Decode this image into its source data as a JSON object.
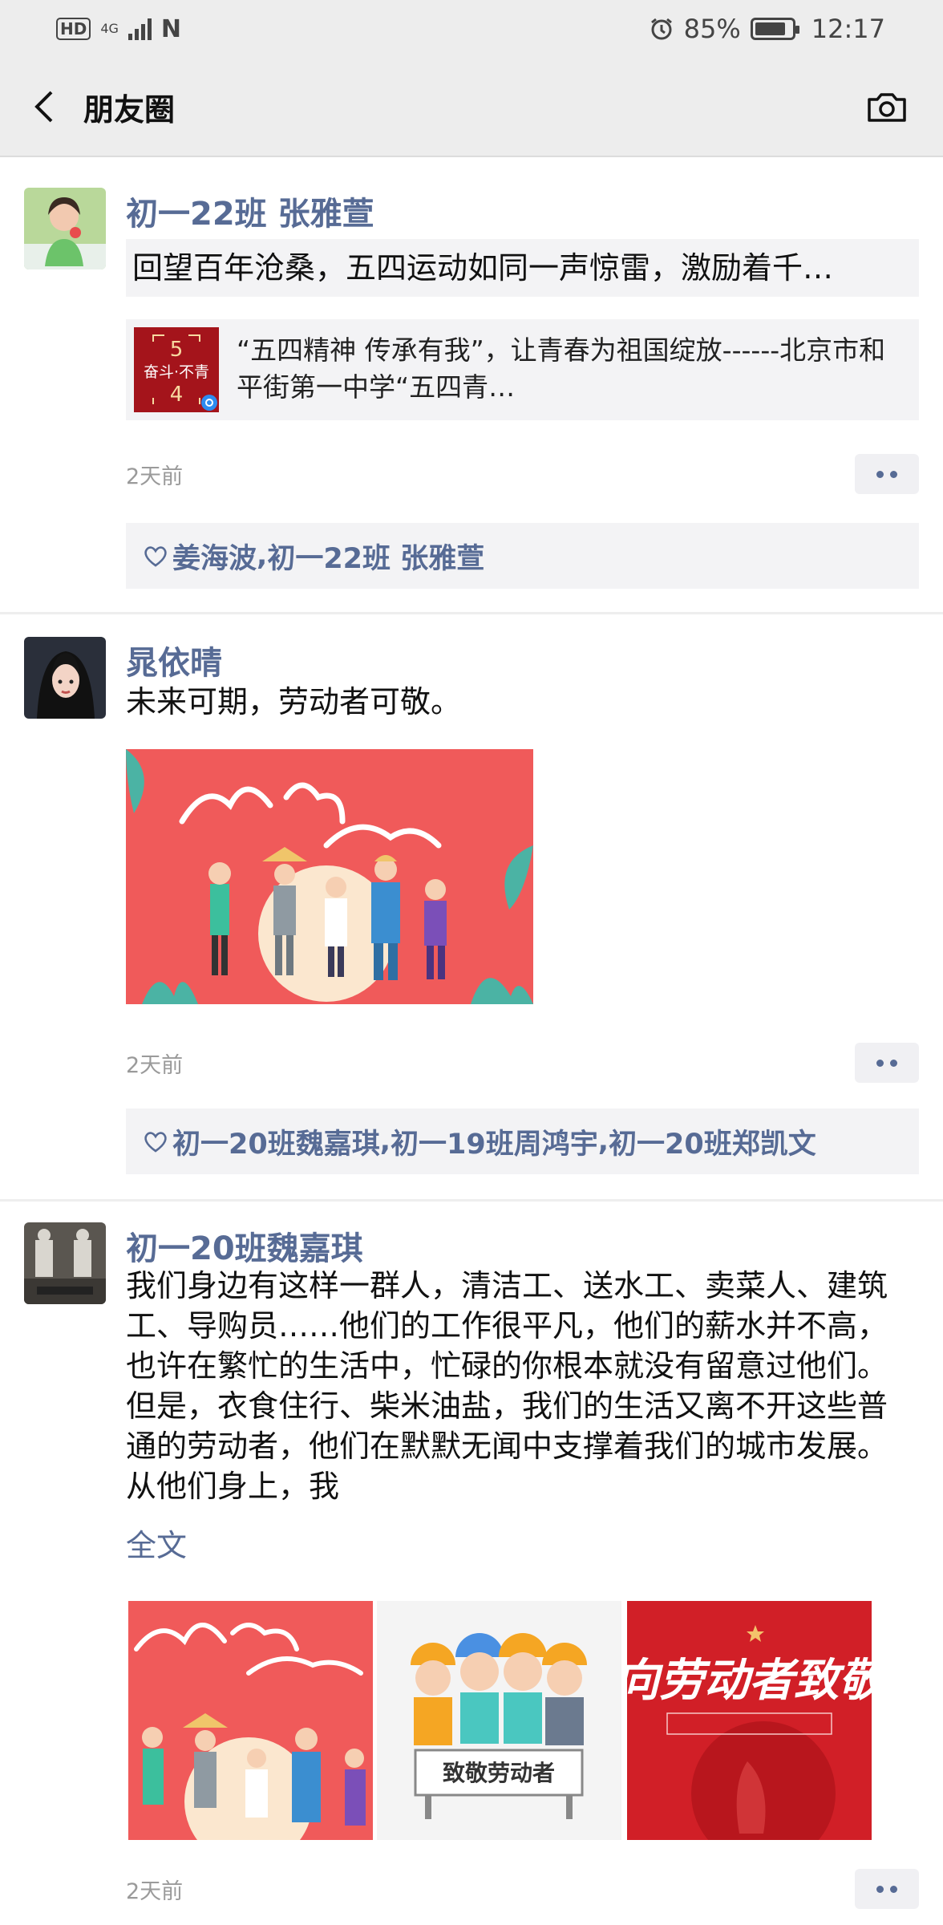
{
  "status_bar": {
    "hd": "HD",
    "network": "4G",
    "battery": "85%",
    "battery_level": 0.85,
    "time": "12:17"
  },
  "nav": {
    "title": "朋友圈",
    "back_icon": "chevron-left-icon",
    "camera_icon": "camera-icon"
  },
  "posts": [
    {
      "author": "初一22班 张雅萱",
      "text": "回望百年沧桑，五四运动如同一声惊雷，激励着千…",
      "link": {
        "thumb_lines": [
          "5",
          "奋斗·不青",
          "4"
        ],
        "title": "“五四精神 传承有我”，让青春为祖国绽放------北京市和平街第一中学“五四青…"
      },
      "time": "2天前",
      "likes": [
        "姜海波",
        "初一22班 张雅萱"
      ]
    },
    {
      "author": "晁依晴",
      "text": "未来可期，劳动者可敬。",
      "time": "2天前",
      "likes": [
        "初一20班魏嘉琪",
        "初一19班周鸿宇",
        "初一20班郑凯文"
      ]
    },
    {
      "author": "初一20班魏嘉琪",
      "text": "我们身边有这样一群人，清洁工、送水工、卖菜人、建筑工、导购员……他们的工作很平凡，他们的薪水并不高，也许在繁忙的生活中，忙碌的你根本就没有留意过他们。但是，衣食住行、柴米油盐，我们的生活又离不开这些普通的劳动者，他们在默默无闻中支撑着我们的城市发展。从他们身上，我",
      "full_text_label": "全文",
      "images": [
        {
          "caption": ""
        },
        {
          "caption": "致敬劳动者"
        },
        {
          "caption": "向劳动者致敬"
        }
      ],
      "time": "2天前"
    }
  ],
  "colors": {
    "link_blue": "#576b95",
    "bar_gray": "#ededed",
    "poster_red": "#f05a5a"
  }
}
